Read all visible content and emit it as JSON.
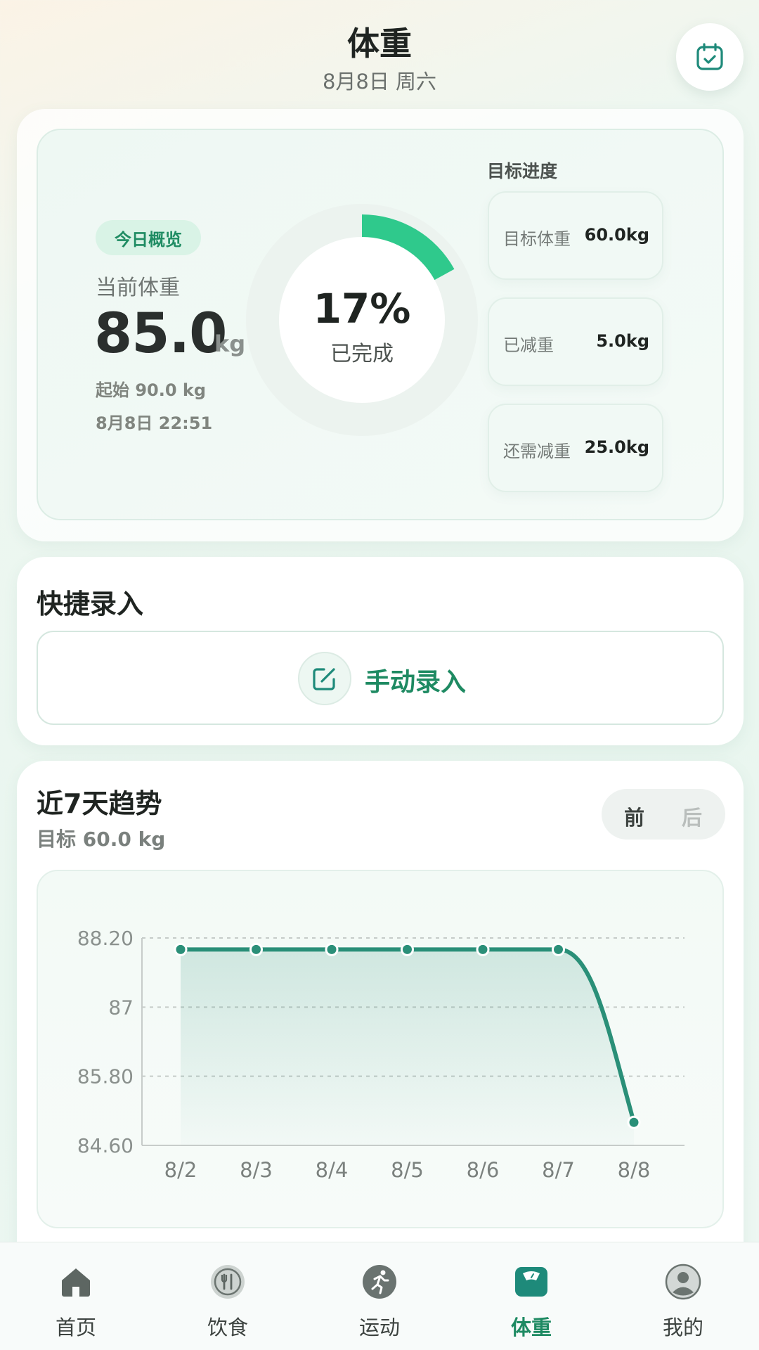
{
  "header": {
    "title": "体重",
    "date": "8月8日 周六",
    "calendar_icon": "calendar-check-icon"
  },
  "overview": {
    "badge": "今日概览",
    "current_label": "当前体重",
    "current_value": "85.0",
    "unit": "kg",
    "start_text": "起始 90.0 kg",
    "time_text": "8月8日 22:51",
    "progress_percent_text": "17%",
    "progress_fraction": 0.17,
    "progress_done_label": "已完成",
    "accent_color": "#2fc98c"
  },
  "goal": {
    "heading": "目标进度",
    "items": [
      {
        "label": "目标体重",
        "value": "60.0kg"
      },
      {
        "label": "已减重",
        "value": "5.0kg"
      },
      {
        "label": "还需减重",
        "value": "25.0kg"
      }
    ]
  },
  "quick": {
    "title": "快捷录入",
    "manual_label": "手动录入",
    "manual_icon": "edit-icon"
  },
  "trend": {
    "title": "近7天趋势",
    "target_text": "目标 60.0 kg",
    "prev_label": "前",
    "next_label": "后"
  },
  "chart_data": {
    "type": "line",
    "x": [
      "8/2",
      "8/3",
      "8/4",
      "8/5",
      "8/6",
      "8/7",
      "8/8"
    ],
    "series": [
      {
        "values": [
          88.0,
          88.0,
          88.0,
          88.0,
          88.0,
          88.0,
          85.0
        ]
      }
    ],
    "ylim": [
      84.6,
      88.2
    ],
    "yticks": [
      84.6,
      85.8,
      87.0,
      88.2
    ],
    "ytick_labels": [
      "84.60",
      "85.80",
      "87",
      "88.20"
    ],
    "grid": true,
    "line_color": "#2a8f78"
  },
  "tabbar": {
    "items": [
      {
        "label": "首页",
        "icon": "home-icon"
      },
      {
        "label": "饮食",
        "icon": "utensils-icon"
      },
      {
        "label": "运动",
        "icon": "running-icon"
      },
      {
        "label": "体重",
        "icon": "scale-icon",
        "active": true
      },
      {
        "label": "我的",
        "icon": "user-icon"
      }
    ]
  }
}
